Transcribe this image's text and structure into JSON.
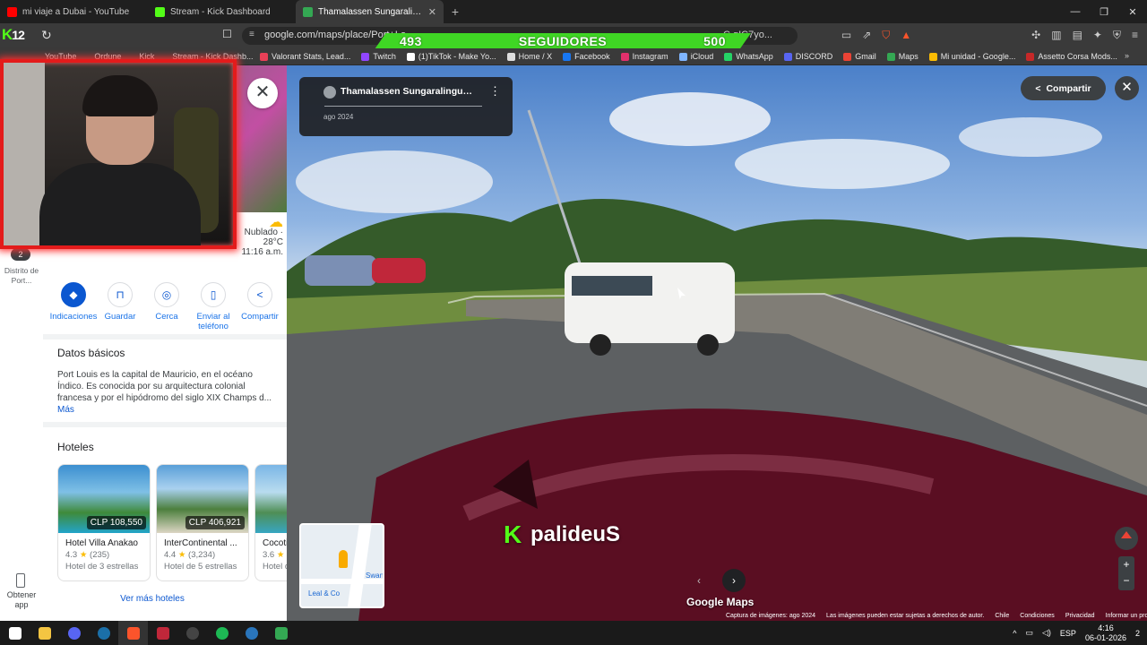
{
  "tabs": [
    {
      "label": "mi viaje a Dubai - YouTube",
      "color": "#ff0000",
      "active": false
    },
    {
      "label": "Stream - Kick Dashboard",
      "color": "#53fc18",
      "active": false
    },
    {
      "label": "Thamalassen Sungaralingum (Go",
      "color": "#34a853",
      "active": true
    }
  ],
  "toolbar": {
    "url": "google.com/maps/place/Port+Lo",
    "url_tail": "C,gIC7yo...",
    "followers_current": "493",
    "followers_label": "SEGUIDORES",
    "followers_goal": "500"
  },
  "bookmarks_hidden": [
    "YouTube",
    "Ordune",
    "Kick",
    "Stream - Kick Dashb..."
  ],
  "bookmarks": [
    {
      "label": "Valorant Stats, Lead...",
      "color": "#e84057"
    },
    {
      "label": "Twitch",
      "color": "#9146ff"
    },
    {
      "label": "(1)TikTok - Make Yo...",
      "color": "#ffffff"
    },
    {
      "label": "Home / X",
      "color": "#dddddd"
    },
    {
      "label": "Facebook",
      "color": "#1877f2"
    },
    {
      "label": "Instagram",
      "color": "#e1306c"
    },
    {
      "label": "iCloud",
      "color": "#7fb5ff"
    },
    {
      "label": "WhatsApp",
      "color": "#25d366"
    },
    {
      "label": "DISCORD",
      "color": "#5865f2"
    },
    {
      "label": "Gmail",
      "color": "#ea4335"
    },
    {
      "label": "Maps",
      "color": "#34a853"
    },
    {
      "label": "Mi unidad - Google...",
      "color": "#fbbc04"
    },
    {
      "label": "Assetto Corsa Mods...",
      "color": "#c62828"
    }
  ],
  "rail": {
    "badge": "2",
    "district": "Distrito de Port...",
    "get_app": "Obtener app"
  },
  "weather": {
    "condition": "Nublado ·",
    "temp": "28°C",
    "time": "11:16 a.m."
  },
  "actions": [
    {
      "label": "Indicaciones",
      "icon": "◆"
    },
    {
      "label": "Guardar",
      "icon": "⊓"
    },
    {
      "label": "Cerca",
      "icon": "◎"
    },
    {
      "label": "Enviar al teléfono",
      "icon": "▯"
    },
    {
      "label": "Compartir",
      "icon": "<"
    }
  ],
  "basics": {
    "title": "Datos básicos",
    "description": "Port Louis es la capital de Mauricio, en el océano Índico. Es conocida por su arquitectura colonial francesa y por el hipódromo del siglo XIX Champs d...",
    "more": "Más"
  },
  "hotels": {
    "title": "Hoteles",
    "items": [
      {
        "name": "Hotel Villa Anakao",
        "price": "CLP 108,550",
        "rating": "4.3",
        "reviews": "(235)",
        "class": "Hotel de 3 estrellas"
      },
      {
        "name": "InterContinental ...",
        "price": "CLP 406,921",
        "rating": "4.4",
        "reviews": "(3,234)",
        "class": "Hotel de 5 estrellas"
      },
      {
        "name": "Cocoti",
        "price": "C",
        "rating": "3.6",
        "reviews": "",
        "class": "Hotel d"
      }
    ],
    "see_more": "Ver más hoteles"
  },
  "streetview": {
    "title": "Thamalassen Sungaralingum (G...",
    "date": "ago 2024",
    "share": "Compartir",
    "watermark": "palideuS",
    "brand": "Google Maps",
    "minimap_labels": [
      "Leal & Co",
      "Swan"
    ],
    "footer": [
      "Captura de imágenes: ago 2024",
      "Las imágenes pueden estar sujetas a derechos de autor.",
      "Chile",
      "Condiciones",
      "Privacidad",
      "Informar un problema"
    ]
  },
  "taskbar": {
    "lang": "ESP",
    "time": "4:16",
    "date": "06-01-2026",
    "notif": "2"
  }
}
